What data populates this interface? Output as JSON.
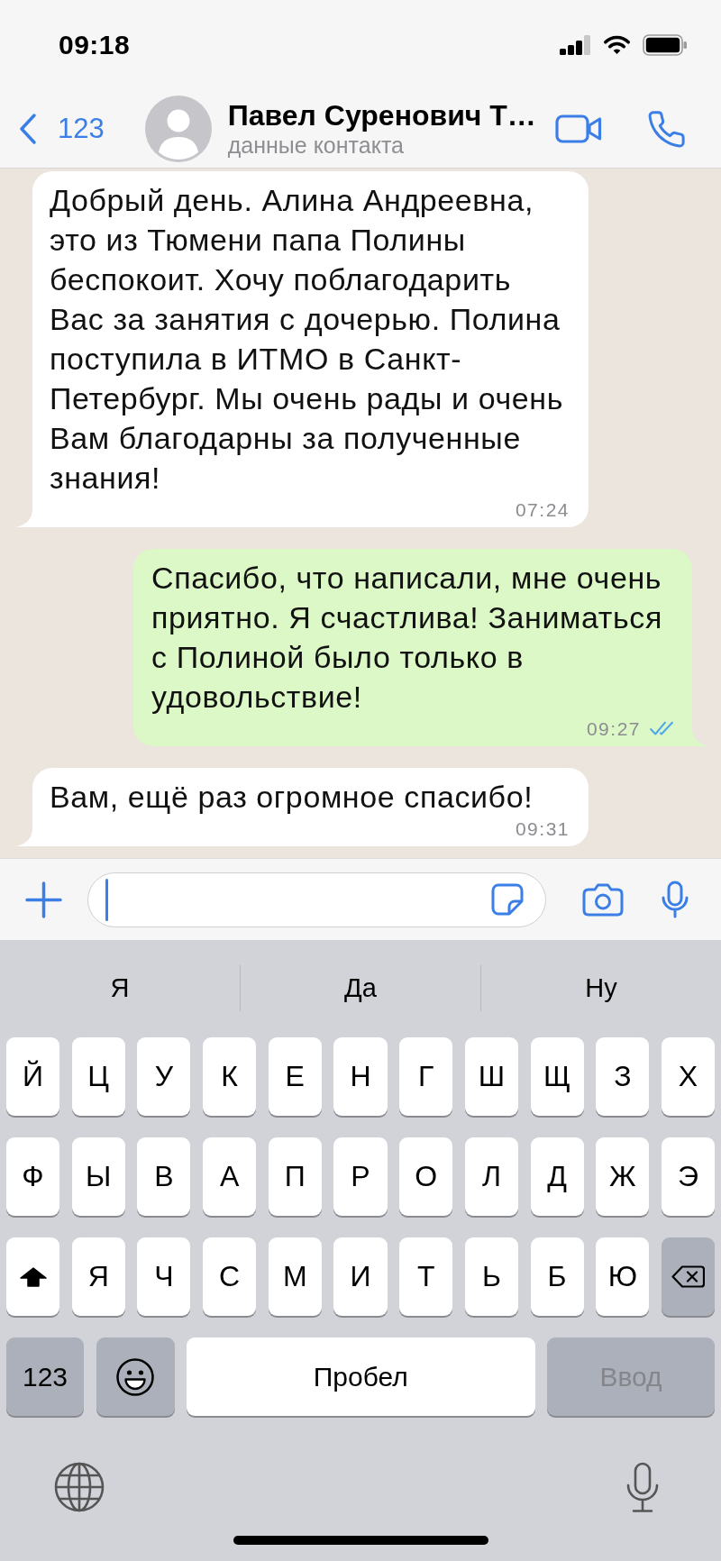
{
  "status_bar": {
    "time": "09:18"
  },
  "header": {
    "back_label": "123",
    "contact_name": "Павел Суренович Т…",
    "subtitle": "данные контакта"
  },
  "messages": [
    {
      "kind": "incoming",
      "text": "Добрый день. Алина Андреевна, это из Тюмени папа Полины беспокоит. Хочу поблагодарить Вас за занятия с дочерью. Полина поступила в ИТМО в Санкт-Петербург. Мы очень рады и очень Вам благодарны за полученные знания!",
      "time": "07:24"
    },
    {
      "kind": "outgoing",
      "text": "Спасибо, что написали, мне очень приятно. Я счастлива! Заниматься с Полиной было только в удовольствие!",
      "time": "09:27",
      "read": true
    },
    {
      "kind": "incoming",
      "text": "Вам, ещё раз огромное спасибо!",
      "time": "09:31"
    }
  ],
  "composer": {
    "focused": true
  },
  "keyboard": {
    "suggestions": [
      "Я",
      "Да",
      "Ну"
    ],
    "rows": [
      [
        {
          "kind": "letter",
          "label": "Й"
        },
        {
          "kind": "letter",
          "label": "Ц"
        },
        {
          "kind": "letter",
          "label": "У"
        },
        {
          "kind": "letter",
          "label": "К"
        },
        {
          "kind": "letter",
          "label": "Е"
        },
        {
          "kind": "letter",
          "label": "Н"
        },
        {
          "kind": "letter",
          "label": "Г"
        },
        {
          "kind": "letter",
          "label": "Ш"
        },
        {
          "kind": "letter",
          "label": "Щ"
        },
        {
          "kind": "letter",
          "label": "З"
        },
        {
          "kind": "letter",
          "label": "Х"
        }
      ],
      [
        {
          "kind": "letter",
          "label": "Ф"
        },
        {
          "kind": "letter",
          "label": "Ы"
        },
        {
          "kind": "letter",
          "label": "В"
        },
        {
          "kind": "letter",
          "label": "А"
        },
        {
          "kind": "letter",
          "label": "П"
        },
        {
          "kind": "letter",
          "label": "Р"
        },
        {
          "kind": "letter",
          "label": "О"
        },
        {
          "kind": "letter",
          "label": "Л"
        },
        {
          "kind": "letter",
          "label": "Д"
        },
        {
          "kind": "letter",
          "label": "Ж"
        },
        {
          "kind": "letter",
          "label": "Э"
        }
      ],
      [
        {
          "kind": "shift",
          "on": true
        },
        {
          "kind": "letter",
          "label": "Я"
        },
        {
          "kind": "letter",
          "label": "Ч"
        },
        {
          "kind": "letter",
          "label": "С"
        },
        {
          "kind": "letter",
          "label": "М"
        },
        {
          "kind": "letter",
          "label": "И"
        },
        {
          "kind": "letter",
          "label": "Т"
        },
        {
          "kind": "letter",
          "label": "Ь"
        },
        {
          "kind": "letter",
          "label": "Б"
        },
        {
          "kind": "letter",
          "label": "Ю"
        },
        {
          "kind": "backspace"
        }
      ]
    ],
    "bottom_row": [
      {
        "kind": "numbers",
        "label": "123"
      },
      {
        "kind": "emoji"
      },
      {
        "kind": "space",
        "label": "Пробел"
      },
      {
        "kind": "return",
        "label": "Ввод",
        "disabled": true
      }
    ]
  }
}
